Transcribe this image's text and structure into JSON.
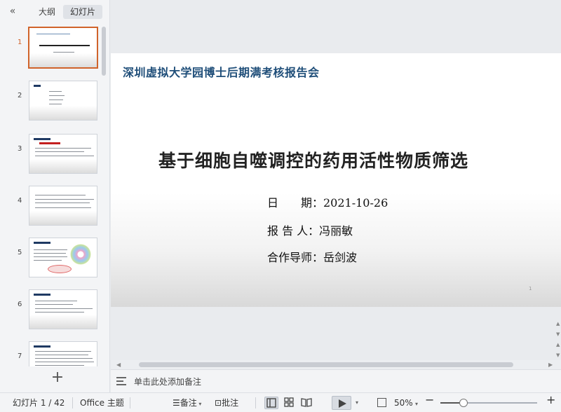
{
  "panel": {
    "tabs": {
      "outline": "大纲",
      "slides": "幻灯片"
    },
    "slides": [
      {
        "num": "1",
        "active": true
      },
      {
        "num": "2",
        "active": false
      },
      {
        "num": "3",
        "active": false
      },
      {
        "num": "4",
        "active": false
      },
      {
        "num": "5",
        "active": false
      },
      {
        "num": "6",
        "active": false
      },
      {
        "num": "7",
        "active": false
      }
    ],
    "add_label": "+"
  },
  "slide": {
    "header": "深圳虚拟大学园博士后期满考核报告会",
    "title": "基于细胞自噬调控的药用活性物质筛选",
    "date_line": "日　　期：2021-10-26",
    "reporter_line": "报  告  人：冯丽敏",
    "advisor_line": "合作导师：岳剑波",
    "page_number": "1"
  },
  "notes": {
    "placeholder": "单击此处添加备注"
  },
  "status": {
    "slide_count": "幻灯片 1 / 42",
    "theme": "Office 主题",
    "notes_label": "备注",
    "comment_label": "批注",
    "zoom": "50%",
    "zoom_fraction": 0.24
  },
  "colors": {
    "accent": "#d0632a",
    "header": "#1f4e79"
  }
}
